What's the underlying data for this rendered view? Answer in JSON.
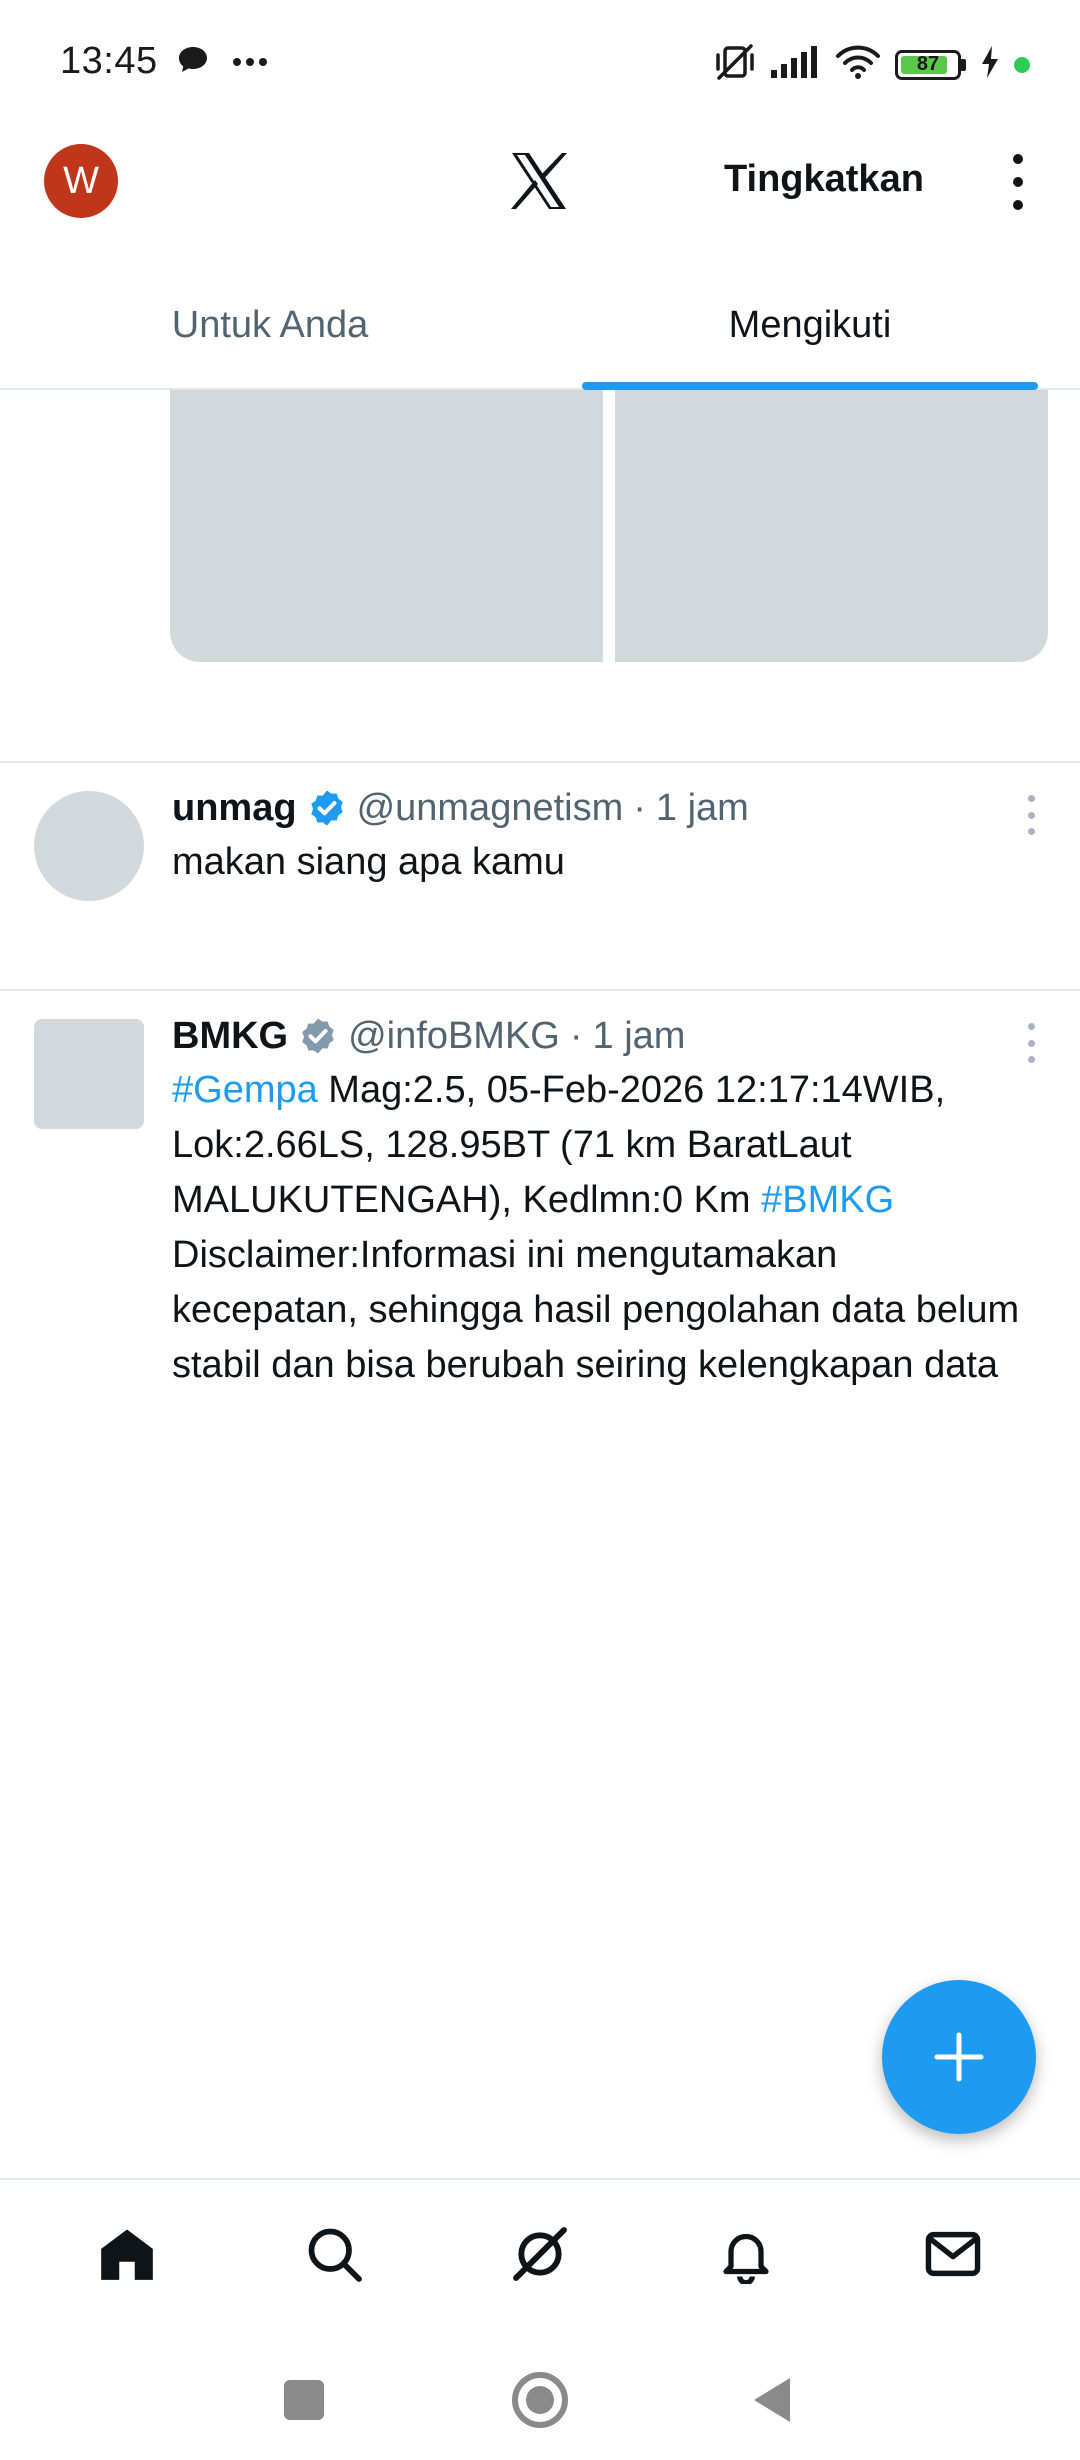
{
  "status_bar": {
    "time": "13:45",
    "battery_level": 87,
    "battery_label": "87",
    "icons": [
      "chat-bubble-icon",
      "more-dots-icon",
      "mute-vibrate-icon",
      "signal-icon",
      "wifi-icon",
      "battery-icon",
      "charging-icon"
    ]
  },
  "header": {
    "avatar_letter": "W",
    "logo": "x-logo",
    "upgrade_label": "Tingkatkan",
    "more_icon": "more-vertical-icon"
  },
  "tabs": [
    {
      "label": "Untuk Anda",
      "active": false
    },
    {
      "label": "Mengikuti",
      "active": true
    }
  ],
  "posts": [
    {
      "name": "unmag",
      "verified": true,
      "handle": "@unmagnetism",
      "separator": "·",
      "time": "1 jam",
      "text": "makan siang apa kamu"
    },
    {
      "name": "BMKG",
      "verified": true,
      "verified_color": "gray",
      "handle": "@infoBMKG",
      "separator": "·",
      "time": "1 jam",
      "text_parts": [
        {
          "text": "#Gempa",
          "hashtag": true
        },
        {
          "text": " Mag:2.5, 05-Feb-2026 12:17:14WIB, Lok:2.66LS, 128.95BT (71 km BaratLaut MALUKUTENGAH), Kedlmn:0 Km ",
          "hashtag": false
        },
        {
          "text": "#BMKG",
          "hashtag": true
        },
        {
          "text": " Disclaimer:Informasi ini mengutamakan kecepatan, sehingga hasil pengolahan data belum stabil dan bisa berubah seiring kelengkapan data",
          "hashtag": false
        }
      ]
    }
  ],
  "fab": {
    "icon": "plus-icon"
  },
  "bottom_nav": [
    "home-icon",
    "search-icon",
    "grok-icon",
    "notifications-icon",
    "messages-icon"
  ],
  "colors": {
    "accent": "#1d9bf0",
    "avatar": "#c0361a",
    "placeholder": "#d1d9dd",
    "text_secondary": "#536471"
  }
}
